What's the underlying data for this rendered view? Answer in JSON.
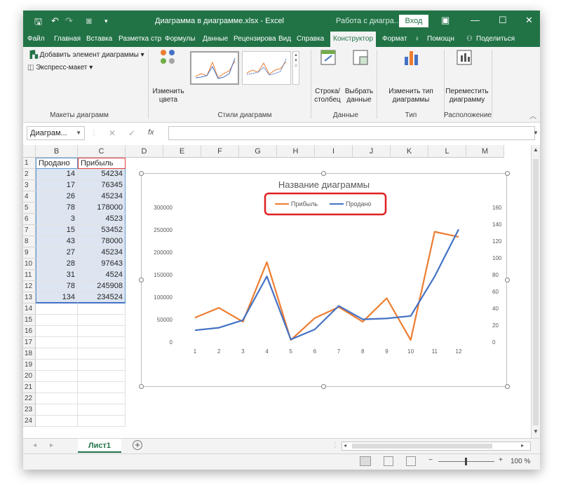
{
  "titlebar": {
    "title": "Диаграмма в диаграмме.xlsx - Excel",
    "context": "Работа с диагра...",
    "login": "Вход"
  },
  "tabs": [
    "Файл",
    "Главная",
    "Вставка",
    "Разметка стр",
    "Формулы",
    "Данные",
    "Рецензирова",
    "Вид",
    "Справка",
    "Конструктор",
    "Формат",
    "Помощн",
    "Поделиться"
  ],
  "ribbon": {
    "add_element": "Добавить элемент диаграммы",
    "express_layout": "Экспресс-макет",
    "group_layouts": "Макеты диаграмм",
    "change_colors_1": "Изменить",
    "change_colors_2": "цвета",
    "group_styles": "Стили диаграмм",
    "switch_1": "Строка/",
    "switch_2": "столбец",
    "select_1": "Выбрать",
    "select_2": "данные",
    "group_data": "Данные",
    "change_type_1": "Изменить тип",
    "change_type_2": "диаграммы",
    "group_type": "Тип",
    "move_1": "Переместить",
    "move_2": "диаграмму",
    "group_location": "Расположение"
  },
  "formula": {
    "namebox": "Диаграм...",
    "fx": "fx"
  },
  "columns": [
    "B",
    "C",
    "D",
    "E",
    "F",
    "G",
    "H",
    "I",
    "J",
    "K",
    "L",
    "M"
  ],
  "rows": [
    "1",
    "2",
    "3",
    "4",
    "5",
    "6",
    "7",
    "8",
    "9",
    "10",
    "11",
    "12",
    "13",
    "14",
    "15",
    "16",
    "17",
    "18",
    "19",
    "20",
    "21",
    "22",
    "23",
    "24"
  ],
  "table": {
    "headers": [
      "Продано",
      "Прибыль"
    ],
    "sold": [
      "14",
      "17",
      "26",
      "78",
      "3",
      "15",
      "43",
      "27",
      "28",
      "31",
      "78",
      "134"
    ],
    "profit": [
      "54234",
      "76345",
      "45234",
      "178000",
      "4523",
      "53452",
      "78000",
      "45234",
      "97643",
      "4524",
      "245908",
      "234524"
    ]
  },
  "chart_data": {
    "type": "line",
    "title": "Название диаграммы",
    "x": [
      1,
      2,
      3,
      4,
      5,
      6,
      7,
      8,
      9,
      10,
      11,
      12
    ],
    "x_tick_labels": [
      "1",
      "2",
      "3",
      "4",
      "5",
      "6",
      "7",
      "8",
      "9",
      "10",
      "11",
      "12"
    ],
    "series": [
      {
        "name": "Прибыль",
        "axis": "left",
        "color": "#ed7d31",
        "values": [
          54234,
          76345,
          45234,
          178000,
          4523,
          53452,
          78000,
          45234,
          97643,
          4524,
          245908,
          234524
        ]
      },
      {
        "name": "Продано",
        "axis": "right",
        "color": "#4472c4",
        "values": [
          14,
          17,
          26,
          78,
          3,
          15,
          43,
          27,
          28,
          31,
          78,
          134
        ]
      }
    ],
    "ylim_left": [
      0,
      300000
    ],
    "y_ticks_left": [
      "0",
      "50000",
      "100000",
      "150000",
      "200000",
      "250000",
      "300000"
    ],
    "ylim_right": [
      0,
      160
    ],
    "y_ticks_right": [
      "0",
      "20",
      "40",
      "60",
      "80",
      "100",
      "120",
      "140",
      "160"
    ],
    "legend_position": "top",
    "grid": false
  },
  "sheet": {
    "name": "Лист1",
    "add": "+"
  },
  "status": {
    "zoom": "100 %"
  },
  "colors": {
    "excel_green": "#217346",
    "legend_highlight": "#e02020"
  }
}
